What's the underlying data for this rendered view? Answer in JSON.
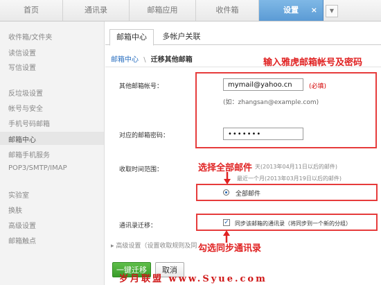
{
  "top_tabs": [
    {
      "label": "首页"
    },
    {
      "label": "通讯录"
    },
    {
      "label": "邮箱应用"
    },
    {
      "label": "收件箱"
    },
    {
      "label": "设置",
      "active": true
    }
  ],
  "top_close": "×",
  "top_more": "▼",
  "sidebar": {
    "items": [
      {
        "label": "收件箱/文件夹"
      },
      {
        "label": "读信设置"
      },
      {
        "label": "写信设置"
      },
      {
        "label": "反垃圾设置"
      },
      {
        "label": "帐号与安全"
      },
      {
        "label": "手机号码邮箱"
      },
      {
        "label": "邮箱中心"
      },
      {
        "label": "邮箱手机服务"
      },
      {
        "label": "POP3/SMTP/IMAP"
      },
      {
        "label": "实验室"
      },
      {
        "label": "换肤"
      },
      {
        "label": "高级设置"
      },
      {
        "label": "邮箱触点"
      }
    ]
  },
  "content_tabs": [
    {
      "label": "邮箱中心"
    },
    {
      "label": "多帐户关联"
    }
  ],
  "breadcrumb": {
    "link": "邮箱中心",
    "sep": "\\",
    "current": "迁移其他邮箱"
  },
  "form": {
    "account_label": "其他邮箱帐号：",
    "account_value": "mymail@yahoo.cn",
    "required": "(必填)",
    "account_hint": "(如：zhangsan@example.com)",
    "password_label": "对应的邮箱密码：",
    "password_value": "•••••••",
    "time_label": "收取时间范围：",
    "time_opt1": "天(2013年04月11日以后的邮件)",
    "time_opt2": "最近一个月(2013年03月19日以后的邮件)",
    "time_opt3": "全部邮件",
    "contacts_label": "通讯录迁移：",
    "contacts_check": "同步该邮箱的通讯录（将同步到一个新的分组）",
    "advanced": "▸ 高级设置（设置收取规则及同"
  },
  "annotations": {
    "a1": "输入雅虎邮箱帐号及密码",
    "a2": "选择全部邮件",
    "a3": "勾选同步通讯录"
  },
  "buttons": {
    "migrate": "一键迁移",
    "cancel": "取消"
  },
  "watermark": "岁月联盟 www.Syue.com"
}
